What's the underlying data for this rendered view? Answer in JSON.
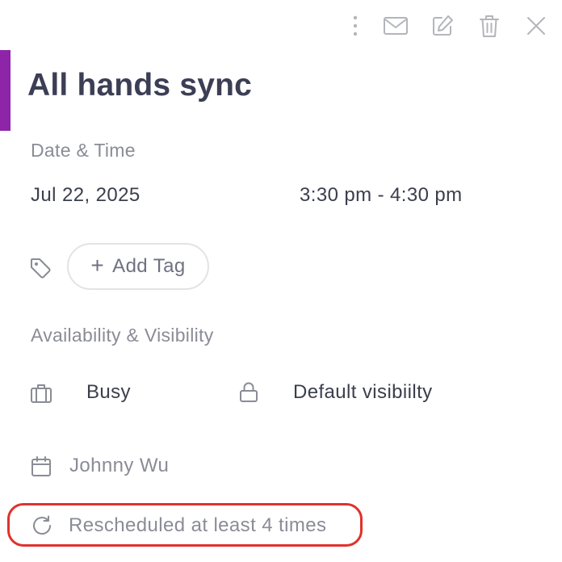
{
  "event": {
    "title": "All hands sync",
    "accent_color": "#8e25a8"
  },
  "toolbar": {
    "more_icon": "more-vertical-icon",
    "email_icon": "mail-icon",
    "edit_icon": "edit-icon",
    "delete_icon": "trash-icon",
    "close_icon": "close-icon"
  },
  "date_time": {
    "label": "Date & Time",
    "date": "Jul 22, 2025",
    "time": "3:30 pm - 4:30 pm"
  },
  "tags": {
    "icon": "tag-icon",
    "add_label": "Add Tag",
    "add_symbol": "+"
  },
  "availability": {
    "label": "Availability & Visibility",
    "status_icon": "briefcase-icon",
    "status": "Busy",
    "visibility_icon": "lock-icon",
    "visibility": "Default visibiilty"
  },
  "calendar": {
    "icon": "calendar-icon",
    "owner": "Johnny Wu"
  },
  "reschedule": {
    "icon": "refresh-icon",
    "text": "Rescheduled at least 4 times",
    "highlight_color": "#e0322c"
  }
}
